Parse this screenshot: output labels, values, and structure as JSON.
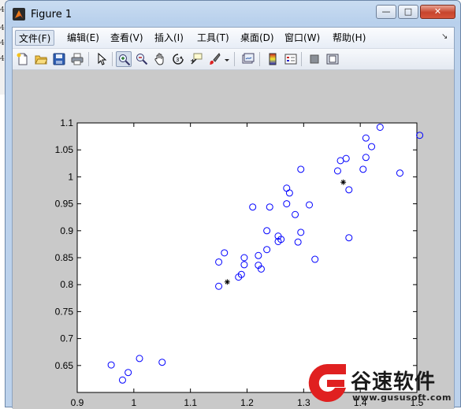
{
  "window": {
    "title": "Figure 1",
    "min_glyph": "—",
    "max_glyph": "□",
    "close_glyph": "✕"
  },
  "left_strip": [
    "4",
    "4",
    "4",
    "4"
  ],
  "menu": {
    "file": "文件(F)",
    "edit": "编辑(E)",
    "view": "查看(V)",
    "insert": "插入(I)",
    "tools": "工具(T)",
    "desktop": "桌面(D)",
    "window": "窗口(W)",
    "help": "帮助(H)",
    "dock": "↘"
  },
  "toolbar": [
    {
      "name": "new-figure-icon"
    },
    {
      "name": "open-file-icon"
    },
    {
      "name": "save-icon"
    },
    {
      "name": "print-icon"
    },
    {
      "name": "select-arrow-icon"
    },
    {
      "name": "zoom-in-icon",
      "pressed": true
    },
    {
      "name": "zoom-out-icon"
    },
    {
      "name": "pan-hand-icon"
    },
    {
      "name": "rotate-3d-icon"
    },
    {
      "name": "data-cursor-icon"
    },
    {
      "name": "brush-icon"
    },
    {
      "name": "brush-dropdown-icon"
    },
    {
      "name": "link-plot-icon"
    },
    {
      "name": "colorbar-icon"
    },
    {
      "name": "legend-icon"
    },
    {
      "name": "hide-plot-tools-icon"
    },
    {
      "name": "show-plot-tools-icon"
    }
  ],
  "chart_data": {
    "type": "scatter",
    "xlim": [
      0.9,
      1.5
    ],
    "ylim": [
      0.6,
      1.1
    ],
    "x_ticks": [
      "0.9",
      "1",
      "1.1",
      "1.2",
      "1.3",
      "1.4",
      "1.5"
    ],
    "y_ticks": [
      "0.65",
      "0.7",
      "0.75",
      "0.8",
      "0.85",
      "0.9",
      "0.95",
      "1",
      "1.05",
      "1.1"
    ],
    "grid": false,
    "series": [
      {
        "marker": "circle",
        "color": "#0000ff",
        "points": [
          [
            0.96,
            0.651
          ],
          [
            0.98,
            0.623
          ],
          [
            0.99,
            0.637
          ],
          [
            1.01,
            0.663
          ],
          [
            1.05,
            0.656
          ],
          [
            1.15,
            0.797
          ],
          [
            1.15,
            0.842
          ],
          [
            1.16,
            0.859
          ],
          [
            1.185,
            0.814
          ],
          [
            1.19,
            0.819
          ],
          [
            1.195,
            0.837
          ],
          [
            1.195,
            0.85
          ],
          [
            1.21,
            0.944
          ],
          [
            1.22,
            0.854
          ],
          [
            1.22,
            0.836
          ],
          [
            1.225,
            0.829
          ],
          [
            1.235,
            0.865
          ],
          [
            1.235,
            0.9
          ],
          [
            1.24,
            0.944
          ],
          [
            1.255,
            0.88
          ],
          [
            1.255,
            0.89
          ],
          [
            1.26,
            0.884
          ],
          [
            1.27,
            0.979
          ],
          [
            1.27,
            0.95
          ],
          [
            1.275,
            0.97
          ],
          [
            1.285,
            0.93
          ],
          [
            1.29,
            0.879
          ],
          [
            1.295,
            1.014
          ],
          [
            1.295,
            0.897
          ],
          [
            1.31,
            0.948
          ],
          [
            1.32,
            0.847
          ],
          [
            1.36,
            1.011
          ],
          [
            1.365,
            1.03
          ],
          [
            1.375,
            1.034
          ],
          [
            1.38,
            0.976
          ],
          [
            1.38,
            0.887
          ],
          [
            1.405,
            1.014
          ],
          [
            1.41,
            1.036
          ],
          [
            1.41,
            1.072
          ],
          [
            1.42,
            1.056
          ],
          [
            1.435,
            1.092
          ],
          [
            1.47,
            1.007
          ],
          [
            1.505,
            1.077
          ]
        ]
      },
      {
        "marker": "star",
        "color": "#000000",
        "points": [
          [
            1.165,
            0.805
          ],
          [
            1.37,
            0.99
          ]
        ]
      }
    ]
  },
  "watermark": {
    "brand": "谷速软件",
    "url": "www.gususoft.com",
    "accent": "#e02020"
  }
}
